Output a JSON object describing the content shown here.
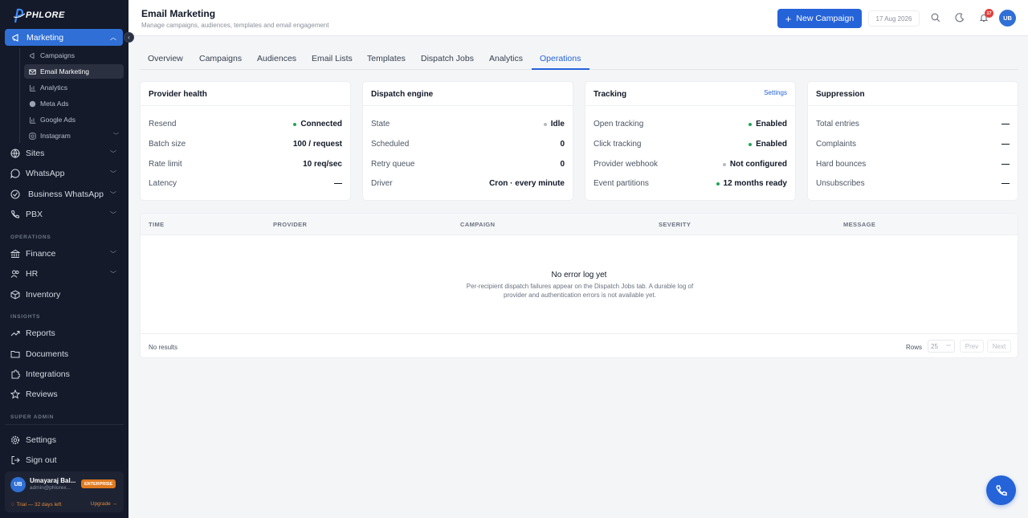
{
  "brand": {
    "name": "PHLORE"
  },
  "sidebar": {
    "active_item": {
      "label": "Marketing",
      "icon": "megaphone-icon"
    },
    "marketing_sub": [
      {
        "label": "Campaigns",
        "icon": "megaphone-icon"
      },
      {
        "label": "Email Marketing",
        "icon": "mail-icon",
        "active": true
      },
      {
        "label": "Analytics",
        "icon": "bar-chart-icon"
      },
      {
        "label": "Meta Ads",
        "icon": "globe-icon"
      },
      {
        "label": "Google Ads",
        "icon": "bar-chart-icon"
      },
      {
        "label": "Instagram",
        "icon": "instagram-icon"
      }
    ],
    "items_main": [
      {
        "label": "Sites",
        "icon": "globe-icon"
      },
      {
        "label": "WhatsApp",
        "icon": "chat-icon"
      },
      {
        "label": "Business WhatsApp",
        "icon": "check-circle-icon"
      },
      {
        "label": "PBX",
        "icon": "phone-icon"
      }
    ],
    "section_operations": "OPERATIONS",
    "items_operations": [
      {
        "label": "Finance",
        "icon": "bank-icon"
      },
      {
        "label": "HR",
        "icon": "users-icon"
      },
      {
        "label": "Inventory",
        "icon": "box-icon"
      }
    ],
    "section_insights": "INSIGHTS",
    "items_insights": [
      {
        "label": "Reports",
        "icon": "trend-icon"
      },
      {
        "label": "Documents",
        "icon": "folder-icon"
      },
      {
        "label": "Integrations",
        "icon": "puzzle-icon"
      },
      {
        "label": "Reviews",
        "icon": "star-icon"
      }
    ],
    "section_super_admin": "SUPER ADMIN",
    "items_bottom": [
      {
        "label": "Settings",
        "icon": "gear-icon"
      },
      {
        "label": "Sign out",
        "icon": "logout-icon"
      }
    ],
    "user": {
      "initials": "UB",
      "name": "Umayaraj Bal...",
      "email": "admin@phlorex...",
      "plan_badge": "ENTERPRISE",
      "trial": "♢ Trial — 32 days left",
      "upgrade": "Upgrade →"
    }
  },
  "header": {
    "title": "Email Marketing",
    "subtitle": "Manage campaigns, audiences, templates and email engagement",
    "new_button": "New Campaign",
    "date": "17 Aug 2026",
    "notification_count": "17",
    "avatar_initials": "UB"
  },
  "tabs": [
    {
      "label": "Overview"
    },
    {
      "label": "Campaigns"
    },
    {
      "label": "Audiences"
    },
    {
      "label": "Email Lists"
    },
    {
      "label": "Templates"
    },
    {
      "label": "Dispatch Jobs"
    },
    {
      "label": "Analytics"
    },
    {
      "label": "Operations",
      "active": true
    }
  ],
  "cards": {
    "provider_health": {
      "title": "Provider health",
      "rows": [
        {
          "label": "Resend",
          "value": "Connected",
          "status": "green"
        },
        {
          "label": "Batch size",
          "value": "100 / request"
        },
        {
          "label": "Rate limit",
          "value": "10 req/sec"
        },
        {
          "label": "Latency",
          "value": "—"
        }
      ]
    },
    "dispatch_engine": {
      "title": "Dispatch engine",
      "rows": [
        {
          "label": "State",
          "value": "Idle",
          "status": "gray"
        },
        {
          "label": "Scheduled",
          "value": "0"
        },
        {
          "label": "Retry queue",
          "value": "0"
        },
        {
          "label": "Driver",
          "value": "Cron · every minute"
        }
      ]
    },
    "tracking": {
      "title": "Tracking",
      "link": "Settings",
      "rows": [
        {
          "label": "Open tracking",
          "value": "Enabled",
          "status": "green"
        },
        {
          "label": "Click tracking",
          "value": "Enabled",
          "status": "green"
        },
        {
          "label": "Provider webhook",
          "value": "Not configured",
          "status": "gray"
        },
        {
          "label": "Event partitions",
          "value": "12 months ready",
          "status": "green"
        }
      ]
    },
    "suppression": {
      "title": "Suppression",
      "rows": [
        {
          "label": "Total entries",
          "value": "—"
        },
        {
          "label": "Complaints",
          "value": "—"
        },
        {
          "label": "Hard bounces",
          "value": "—"
        },
        {
          "label": "Unsubscribes",
          "value": "—"
        }
      ]
    }
  },
  "error_table": {
    "columns": [
      "TIME",
      "PROVIDER",
      "CAMPAIGN",
      "SEVERITY",
      "MESSAGE"
    ],
    "empty_title": "No error log yet",
    "empty_desc": "Per-recipient dispatch failures appear on the Dispatch Jobs tab. A durable log of provider and authentication errors is not available yet.",
    "footer_status": "No results",
    "rows_label": "Rows",
    "rows_value": "25",
    "prev": "Prev",
    "next": "Next"
  },
  "colors": {
    "accent": "#2563d9",
    "sidebar_bg": "#141a2a",
    "status_green": "#22a55a",
    "status_gray": "#b5b9c1"
  }
}
